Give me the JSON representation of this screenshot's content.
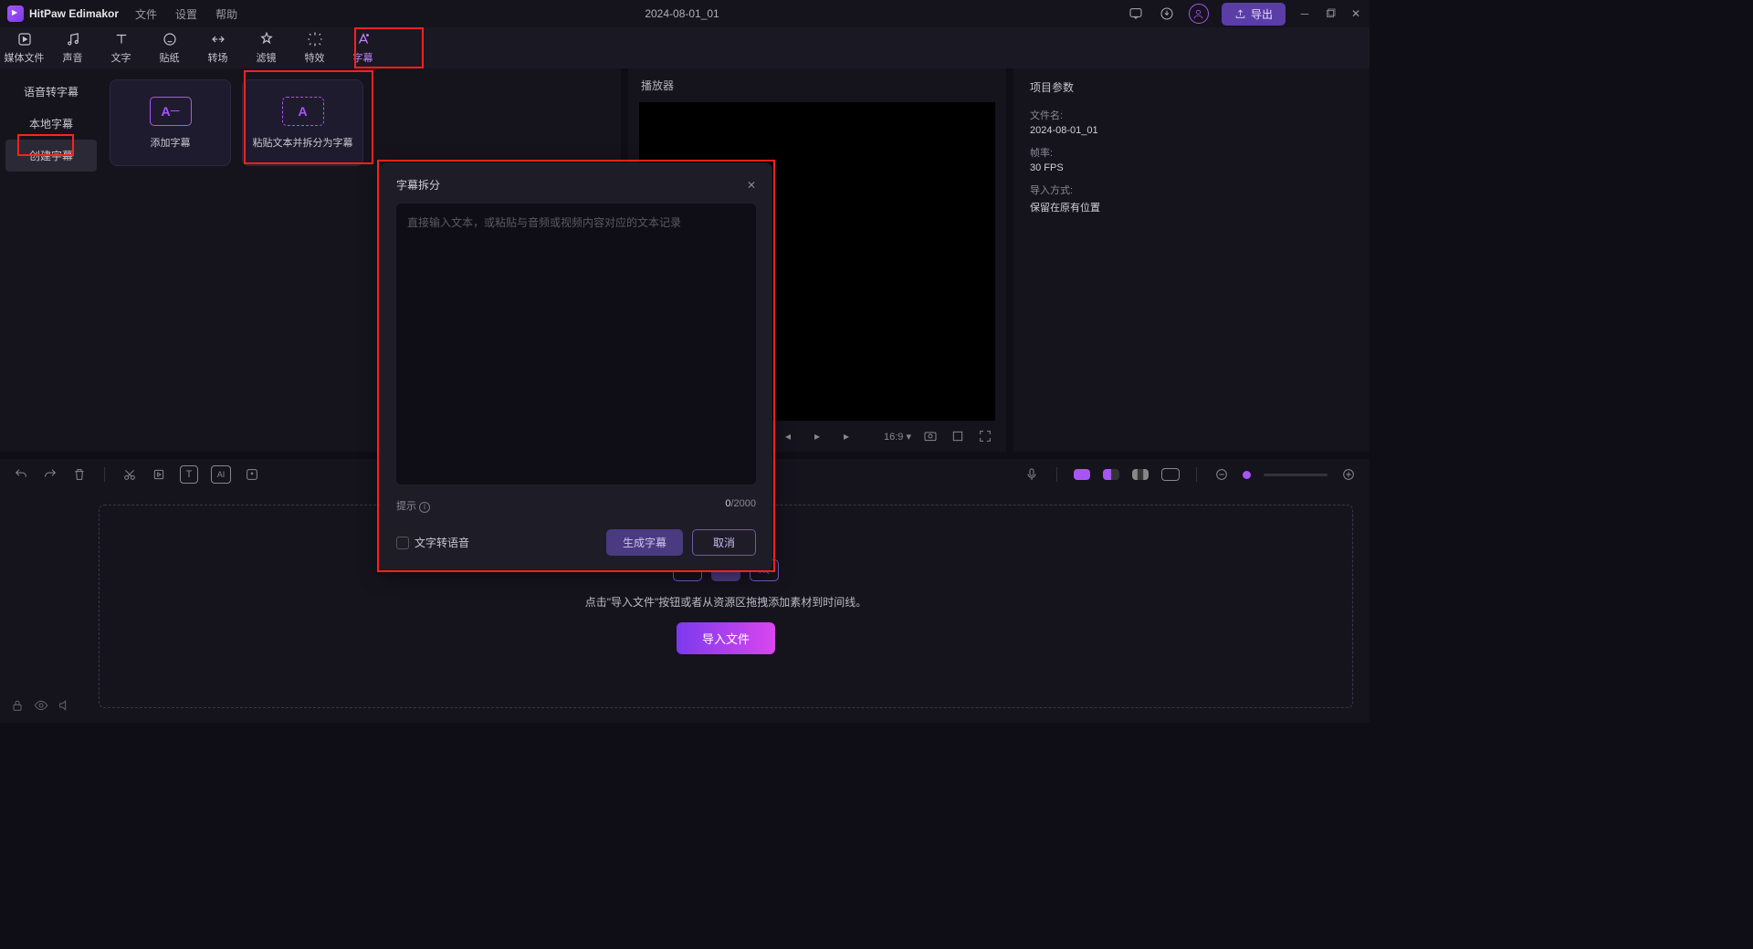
{
  "app": {
    "name": "HitPaw Edimakor",
    "project_title": "2024-08-01_01"
  },
  "menu": {
    "file": "文件",
    "settings": "设置",
    "help": "帮助"
  },
  "titlebar": {
    "export": "导出"
  },
  "toolbar": {
    "tabs": [
      {
        "label": "媒体文件"
      },
      {
        "label": "声音"
      },
      {
        "label": "文字"
      },
      {
        "label": "贴纸"
      },
      {
        "label": "转场"
      },
      {
        "label": "滤镜"
      },
      {
        "label": "特效"
      },
      {
        "label": "字幕"
      }
    ]
  },
  "sidebar": {
    "items": [
      {
        "label": "语音转字幕"
      },
      {
        "label": "本地字幕"
      },
      {
        "label": "创建字幕"
      }
    ]
  },
  "cards": {
    "add": "添加字幕",
    "paste": "粘贴文本并拆分为字幕"
  },
  "player": {
    "header": "播放器",
    "aspect": "16:9"
  },
  "props": {
    "header": "项目参数",
    "filename_label": "文件名:",
    "filename": "2024-08-01_01",
    "fps_label": "帧率:",
    "fps": "30 FPS",
    "import_label": "导入方式:",
    "import_mode": "保留在原有位置"
  },
  "timeline": {
    "drop_text": "点击\"导入文件\"按钮或者从资源区拖拽添加素材到时间线。",
    "import_btn": "导入文件"
  },
  "modal": {
    "title": "字幕拆分",
    "placeholder": "直接输入文本，或粘贴与音频或视频内容对应的文本记录",
    "hint_label": "提示",
    "count_cur": "0",
    "count_sep": "/",
    "count_max": "2000",
    "tts_label": "文字转语音",
    "generate": "生成字幕",
    "cancel": "取消"
  }
}
